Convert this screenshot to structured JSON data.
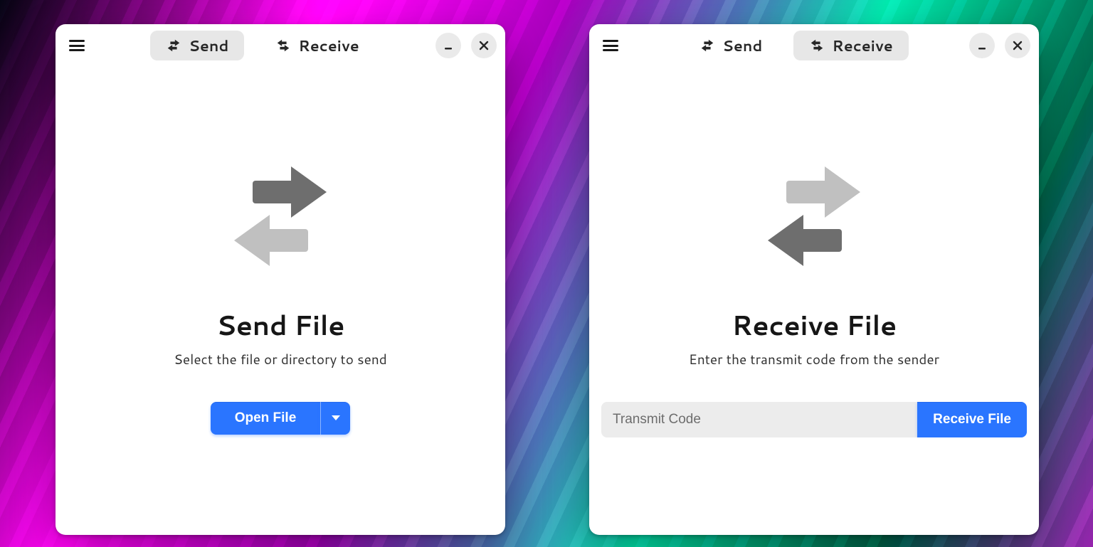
{
  "tabs": {
    "send_label": "Send",
    "receive_label": "Receive"
  },
  "send_window": {
    "active_tab": "send",
    "title": "Send File",
    "subtitle": "Select the file or directory to send",
    "open_button_label": "Open File"
  },
  "receive_window": {
    "active_tab": "receive",
    "title": "Receive File",
    "subtitle": "Enter the transmit code from the sender",
    "input_placeholder": "Transmit Code",
    "receive_button_label": "Receive File"
  },
  "colors": {
    "accent": "#3b74e0"
  }
}
